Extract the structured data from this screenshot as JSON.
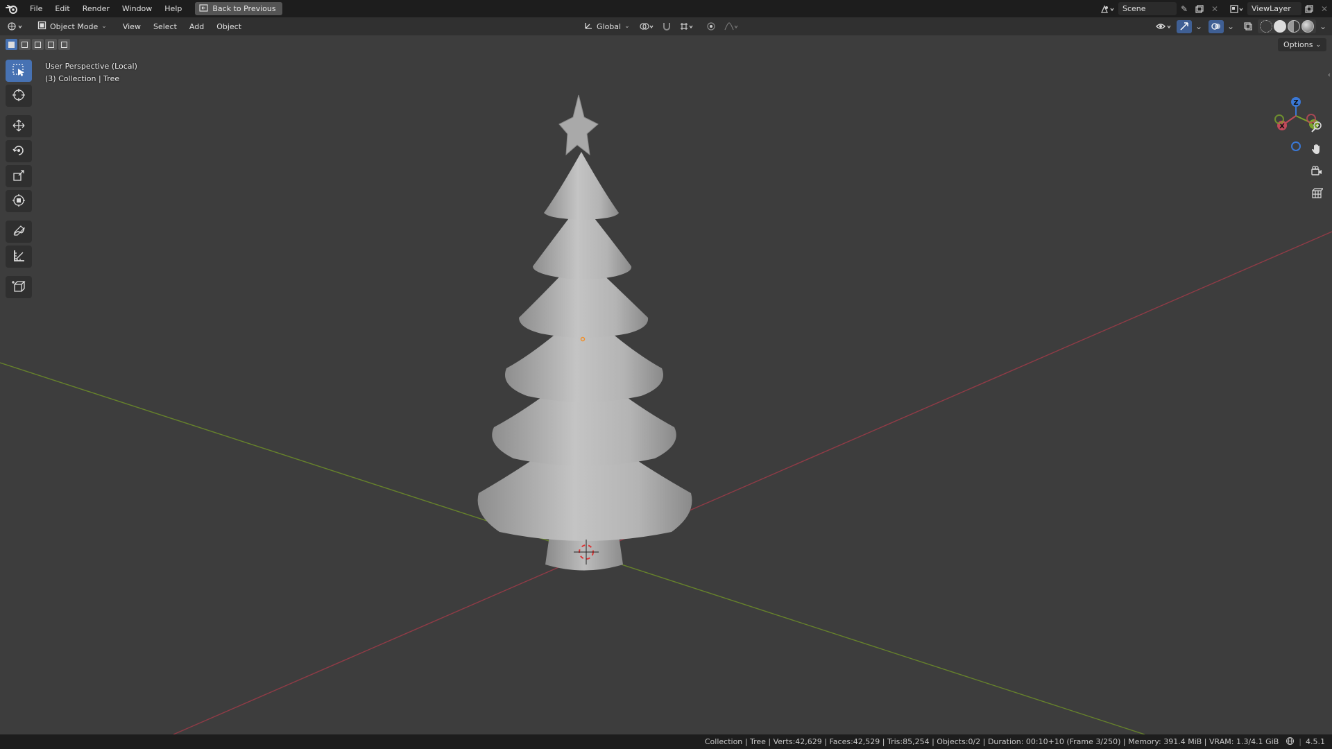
{
  "topbar": {
    "menus": [
      "File",
      "Edit",
      "Render",
      "Window",
      "Help"
    ],
    "back_button": "Back to Previous",
    "scene": "Scene",
    "view_layer": "ViewLayer"
  },
  "header": {
    "mode": "Object Mode",
    "menus": [
      "View",
      "Select",
      "Add",
      "Object"
    ],
    "transform_orientation": "Global",
    "options_label": "Options"
  },
  "toolbar": {
    "tools": [
      "select-box",
      "cursor",
      "move",
      "rotate",
      "scale",
      "transform",
      "annotate",
      "measure",
      "add-cube"
    ],
    "active_tool": "select-box"
  },
  "viewport": {
    "perspective_label": "User Perspective (Local)",
    "collection_label": "(3) Collection | Tree",
    "object": "Tree",
    "gizmo_axes": [
      "X",
      "Y",
      "Z"
    ]
  },
  "status": {
    "text": "Collection | Tree | Verts:42,629 | Faces:42,529 | Tris:85,254 | Objects:0/2 | Duration: 00:10+10 (Frame 3/250) | Memory: 391.4 MiB | VRAM: 1.3/4.1 GiB",
    "version": "4.5.1"
  },
  "colors": {
    "accent": "#4772b3",
    "x_axis": "#c24a5a",
    "y_axis": "#7ba32a",
    "z_axis": "#3a78d6",
    "viewport_bg": "#3d3d3d"
  }
}
